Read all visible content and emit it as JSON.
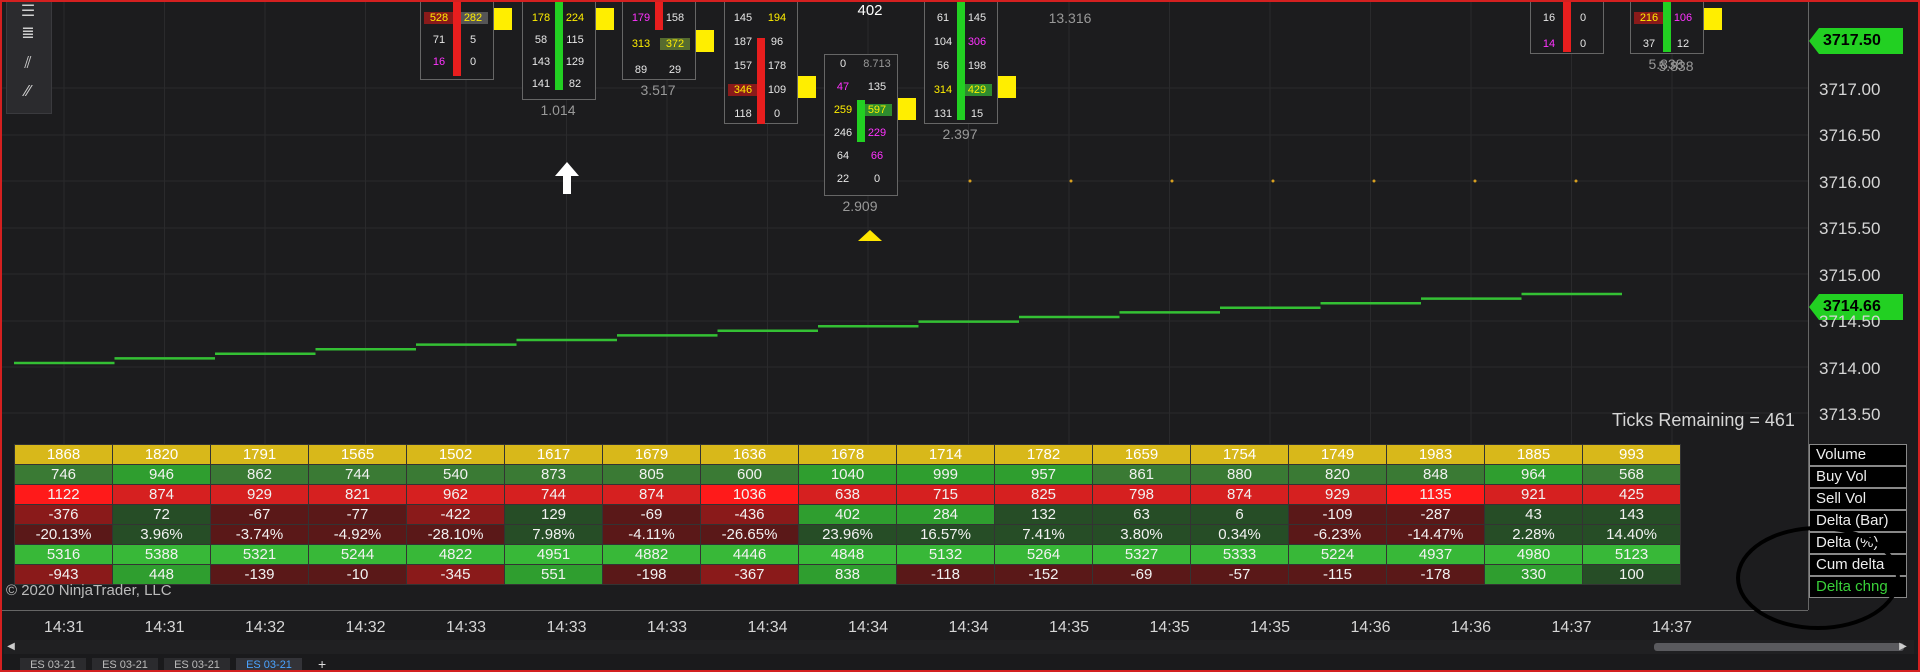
{
  "toolbar": {
    "icons": [
      "menu-icon",
      "list-icon",
      "drawing-tool-icon",
      "line-tool-icon"
    ]
  },
  "price_axis": {
    "labels": [
      "3717.00",
      "3716.50",
      "3716.00",
      "3715.50",
      "3715.00",
      "3714.50",
      "3714.00",
      "3713.50"
    ],
    "current_price": "3717.50",
    "indicator_price": "3714.66"
  },
  "ticks_remaining": "Ticks Remaining = 461",
  "footprint": {
    "top_value": "402",
    "box1": {
      "rows": [
        [
          "528",
          "282"
        ],
        [
          "71",
          "5"
        ],
        [
          "16",
          "0"
        ]
      ]
    },
    "box2": {
      "rows": [
        [
          "178",
          "224"
        ],
        [
          "58",
          "115"
        ],
        [
          "143",
          "129"
        ],
        [
          "141",
          "82"
        ]
      ],
      "total": "1.014"
    },
    "box3": {
      "rows": [
        [
          "179",
          "158"
        ],
        [
          "313",
          "372"
        ],
        [
          "89",
          "29"
        ]
      ],
      "total": "3.517"
    },
    "box4": {
      "rows": [
        [
          "145",
          "194"
        ],
        [
          "187",
          "96"
        ],
        [
          "157",
          "178"
        ],
        [
          "346",
          "109"
        ],
        [
          "118",
          "0"
        ]
      ]
    },
    "box5": {
      "rows": [
        [
          "0",
          "8.713"
        ],
        [
          "47",
          "135"
        ],
        [
          "259",
          "597"
        ],
        [
          "246",
          "229"
        ],
        [
          "64",
          "66"
        ],
        [
          "22",
          "0"
        ]
      ],
      "total": "2.909"
    },
    "box6": {
      "rows": [
        [
          "61",
          "145"
        ],
        [
          "104",
          "306"
        ],
        [
          "56",
          "198"
        ],
        [
          "314",
          "429"
        ],
        [
          "131",
          "15"
        ]
      ],
      "total": "2.397"
    },
    "box7": {
      "total": "13.316"
    },
    "box8": {
      "rows": [
        [
          "16",
          "0"
        ],
        [
          "14",
          "0"
        ]
      ]
    },
    "box9": {
      "rows": [
        [
          "216",
          "106"
        ],
        [
          "37",
          "12"
        ]
      ],
      "total": "5.838"
    }
  },
  "table": {
    "row_labels": [
      "Volume",
      "Buy Vol",
      "Sell Vol",
      "Delta (Bar)",
      "Delta (%)",
      "Cum delta",
      "Delta chng"
    ],
    "rows": [
      [
        "1868",
        "1820",
        "1791",
        "1565",
        "1502",
        "1617",
        "1679",
        "1636",
        "1678",
        "1714",
        "1782",
        "1659",
        "1754",
        "1749",
        "1983",
        "1885",
        "993"
      ],
      [
        "746",
        "946",
        "862",
        "744",
        "540",
        "873",
        "805",
        "600",
        "1040",
        "999",
        "957",
        "861",
        "880",
        "820",
        "848",
        "964",
        "568"
      ],
      [
        "1122",
        "874",
        "929",
        "821",
        "962",
        "744",
        "874",
        "1036",
        "638",
        "715",
        "825",
        "798",
        "874",
        "929",
        "1135",
        "921",
        "425"
      ],
      [
        "-376",
        "72",
        "-67",
        "-77",
        "-422",
        "129",
        "-69",
        "-436",
        "402",
        "284",
        "132",
        "63",
        "6",
        "-109",
        "-287",
        "43",
        "143"
      ],
      [
        "-20.13%",
        "3.96%",
        "-3.74%",
        "-4.92%",
        "-28.10%",
        "7.98%",
        "-4.11%",
        "-26.65%",
        "23.96%",
        "16.57%",
        "7.41%",
        "3.80%",
        "0.34%",
        "-6.23%",
        "-14.47%",
        "2.28%",
        "14.40%"
      ],
      [
        "5316",
        "5388",
        "5321",
        "5244",
        "4822",
        "4951",
        "4882",
        "4446",
        "4848",
        "5132",
        "5264",
        "5327",
        "5333",
        "5224",
        "4937",
        "4980",
        "5123"
      ],
      [
        "-943",
        "448",
        "-139",
        "-10",
        "-345",
        "551",
        "-198",
        "-367",
        "838",
        "-118",
        "-152",
        "-69",
        "-57",
        "-115",
        "-178",
        "330",
        "100"
      ]
    ]
  },
  "copyright": "© 2020 NinjaTrader, LLC",
  "time_axis": [
    "14:31",
    "14:31",
    "14:32",
    "14:32",
    "14:33",
    "14:33",
    "14:33",
    "14:34",
    "14:34",
    "14:34",
    "14:35",
    "14:35",
    "14:35",
    "14:36",
    "14:36",
    "14:37",
    "14:37"
  ],
  "tabs": [
    "ES 03-21",
    "ES 03-21",
    "ES 03-21",
    "ES 03-21"
  ],
  "active_tab_index": 3,
  "colors": {
    "up_green": "#22d022",
    "down_red": "#e81e1e",
    "volume_gold": "#d8b81a",
    "line_green": "#34c034",
    "imbalance_yellow": "#ffee00"
  }
}
